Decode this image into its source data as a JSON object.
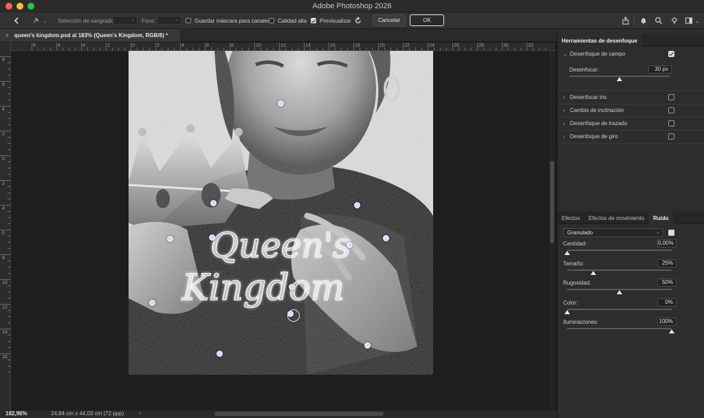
{
  "app": {
    "title": "Adobe Photoshop 2026"
  },
  "options_bar": {
    "bleed_selection_label": "Selección de sangrado:",
    "focus_label": "Foco:",
    "save_mask_label": "Guardar máscara para canales",
    "save_mask_checked": false,
    "high_quality_label": "Calidad alta",
    "high_quality_checked": false,
    "preview_label": "Previsualizar",
    "preview_checked": true,
    "cancel_label": "Cancelar",
    "ok_label": "OK"
  },
  "document": {
    "tab_title": "queen's kingdom.psd al 183% (Queen's Kingdom, RGB/8) *",
    "artwork_text": "Queen's Kingdom"
  },
  "rulers": {
    "horizontal_labels": [
      "8",
      "6",
      "4",
      "2",
      "0",
      "2",
      "4",
      "6",
      "8",
      "10",
      "12",
      "14",
      "16",
      "18",
      "20",
      "22",
      "24",
      "26",
      "28",
      "30",
      "32"
    ],
    "vertical_labels": [
      "8",
      "6",
      "4",
      "2",
      "0",
      "2",
      "4",
      "6",
      "8",
      "10",
      "12",
      "14",
      "16"
    ]
  },
  "status": {
    "zoom": "182,96%",
    "dimensions": "24,84 cm x 44,03 cm (72 ppp)",
    "arrow": "›"
  },
  "blur_tools_panel": {
    "tab_label": "Herramientas de desenfoque",
    "items": [
      {
        "label": "Desenfoque de campo",
        "checked": true,
        "expanded": true
      },
      {
        "label": "Desenfocar iris",
        "checked": false,
        "expanded": false
      },
      {
        "label": "Cambio de inclinación",
        "checked": false,
        "expanded": false
      },
      {
        "label": "Desenfoque de trazado",
        "checked": false,
        "expanded": false
      },
      {
        "label": "Desenfoque de giro",
        "checked": false,
        "expanded": false
      }
    ],
    "blur_label": "Desenfocar:",
    "blur_value": "30 px",
    "blur_level": 0.5
  },
  "effects_panel": {
    "tabs": [
      "Efectos",
      "Efectos de movimiento",
      "Ruido"
    ],
    "active_tab": "Ruido",
    "noise_type": "Granulado",
    "noise_enabled": true,
    "sliders": [
      {
        "label": "Cantidad:",
        "value": "0,00%",
        "level": 0.0
      },
      {
        "label": "Tamaño:",
        "value": "25%",
        "level": 0.25
      },
      {
        "label": "Rugosidad:",
        "value": "50%",
        "level": 0.5
      },
      {
        "label": "Color:",
        "value": "0%",
        "level": 0.0
      },
      {
        "label": "Iluminaciones:",
        "value": "100%",
        "level": 1.0
      }
    ]
  },
  "colors": {
    "canvas_bg": "#1e1e1e",
    "blur_pin": "#cfdcff",
    "ok_border": "#e6e6e6"
  }
}
